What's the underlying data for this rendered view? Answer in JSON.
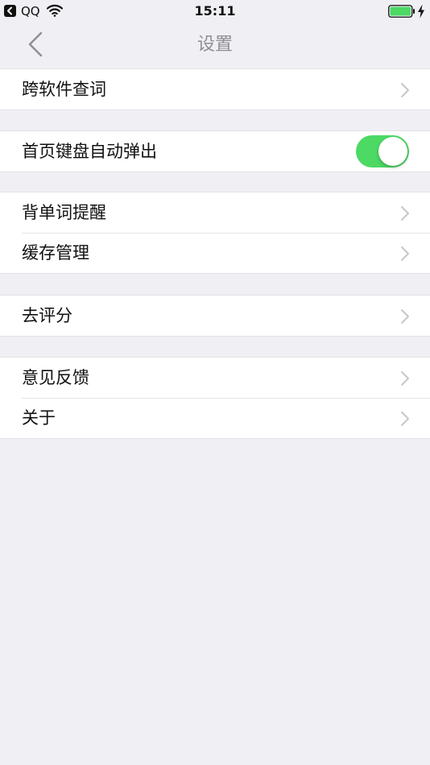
{
  "status_bar": {
    "back_app": "QQ",
    "time": "15:11"
  },
  "nav": {
    "title": "设置"
  },
  "groups": [
    {
      "rows": [
        {
          "label": "跨软件查词",
          "accessory": "chevron-right-icon"
        }
      ]
    },
    {
      "rows": [
        {
          "label": "首页键盘自动弹出",
          "accessory": "toggle",
          "toggle_on": true
        }
      ]
    },
    {
      "rows": [
        {
          "label": "背单词提醒",
          "accessory": "chevron-right-icon"
        },
        {
          "label": "缓存管理",
          "accessory": "chevron-right-icon"
        }
      ]
    },
    {
      "rows": [
        {
          "label": "去评分",
          "accessory": "chevron-right-icon"
        }
      ]
    },
    {
      "rows": [
        {
          "label": "意见反馈",
          "accessory": "chevron-right-icon"
        },
        {
          "label": "关于",
          "accessory": "chevron-right-icon"
        }
      ]
    }
  ],
  "colors": {
    "background": "#efeff4",
    "toggle_on": "#4cd964",
    "battery_fill": "#4cd964",
    "title": "#8e8e93",
    "chevron": "#c7c7cc"
  }
}
